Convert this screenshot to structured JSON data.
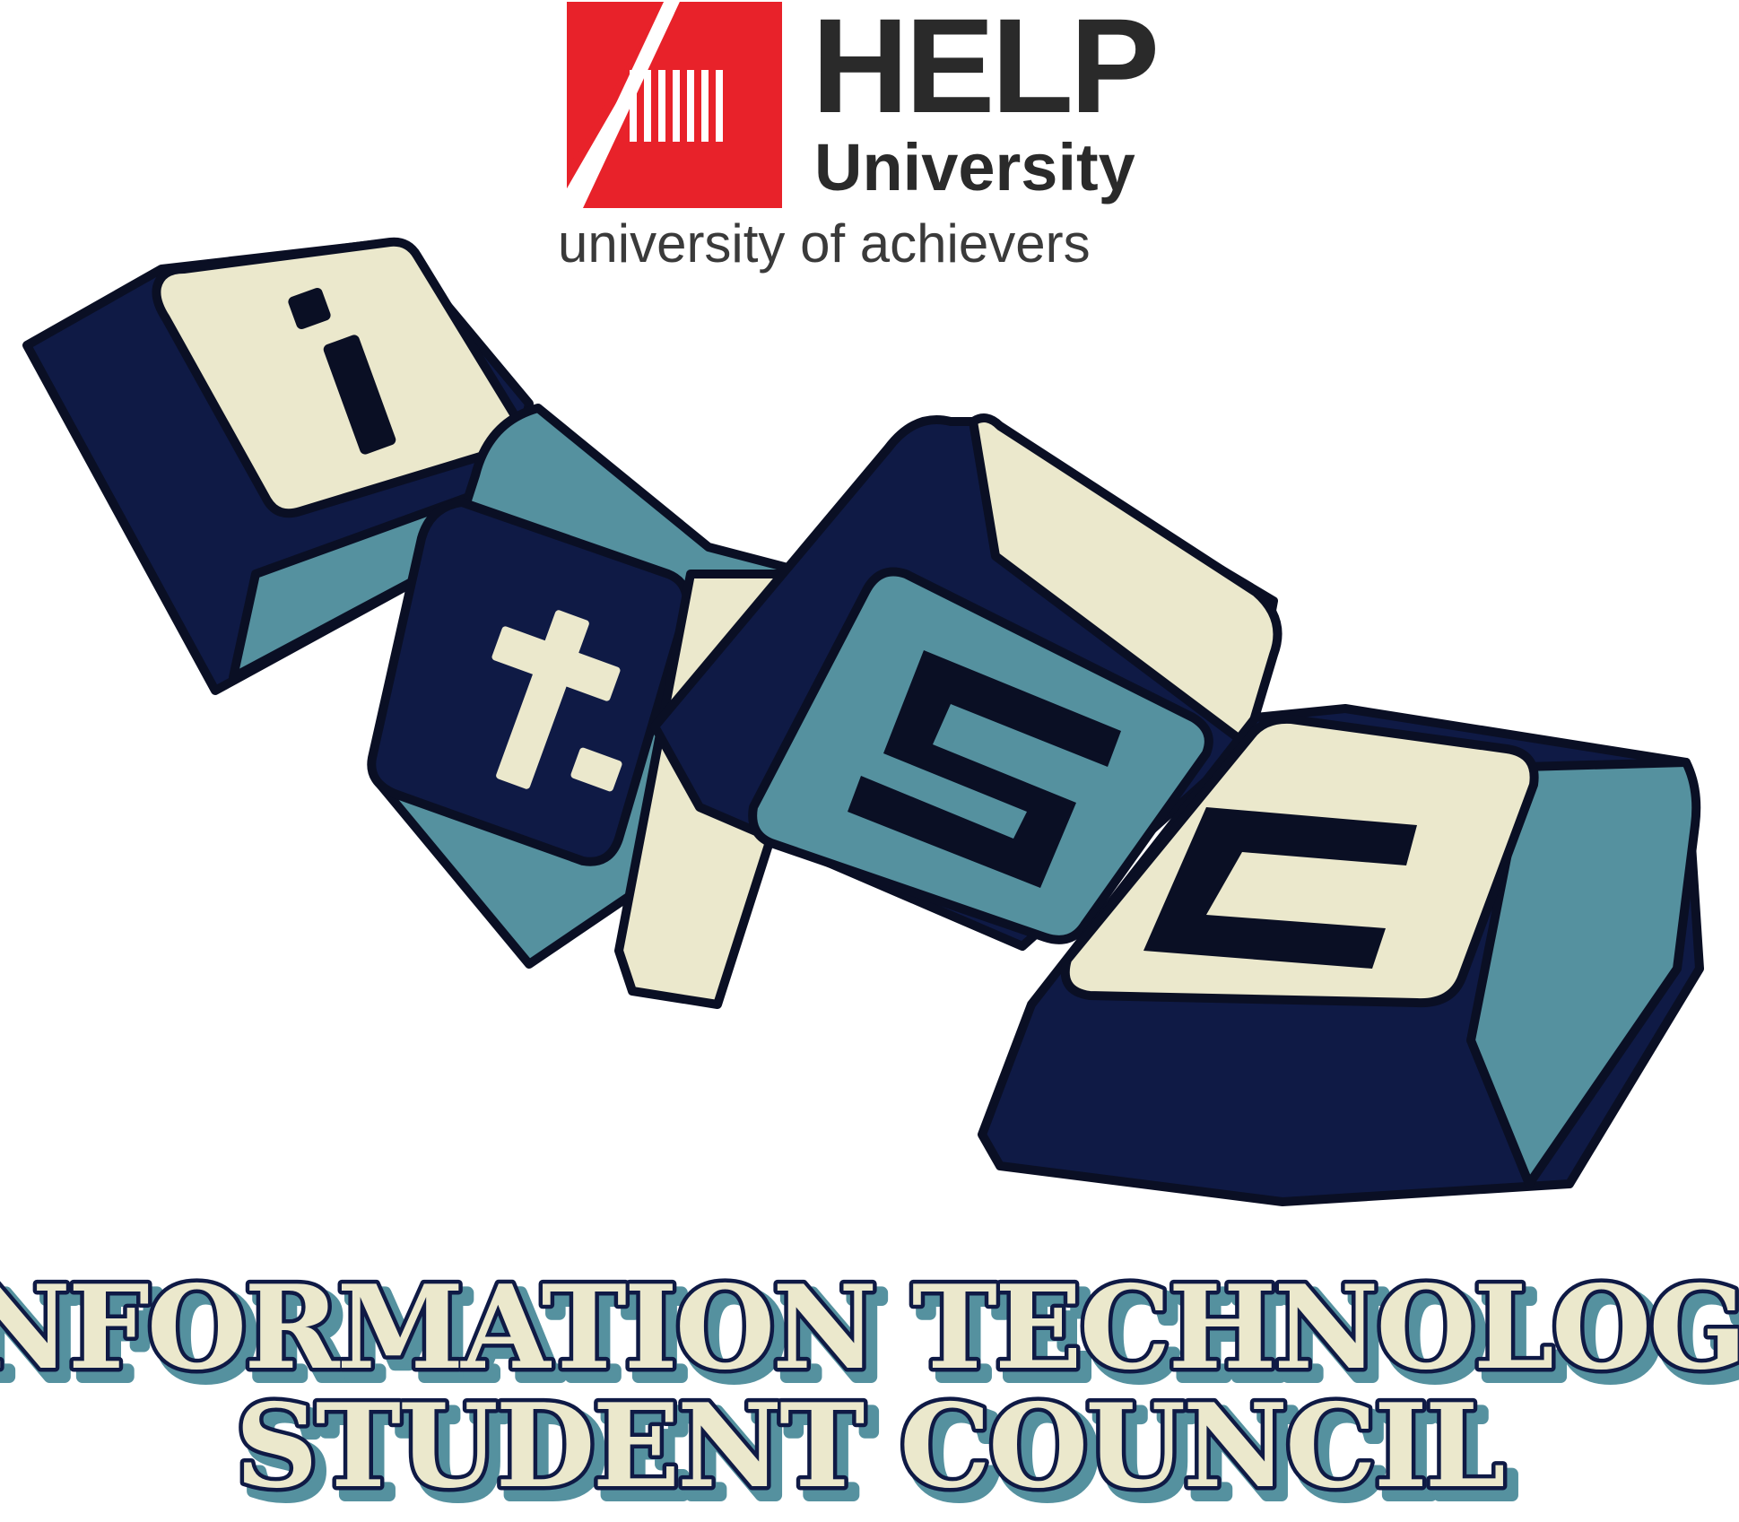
{
  "header": {
    "brand": "HELP",
    "brand_sub": "University",
    "tagline": "university of achievers"
  },
  "keycaps": [
    {
      "letter": "i"
    },
    {
      "letter": "t"
    },
    {
      "letter": "s"
    },
    {
      "letter": "c"
    }
  ],
  "footer": {
    "line1": "INFORMATION TECHNOLOGY",
    "line2": "STUDENT COUNCIL"
  },
  "colors": {
    "brand_red": "#e8222a",
    "navy": "#0f1a45",
    "teal": "#55919f",
    "cream": "#ebe8cc",
    "outline": "#0a0f24",
    "text_gray": "#3a3a3a"
  }
}
